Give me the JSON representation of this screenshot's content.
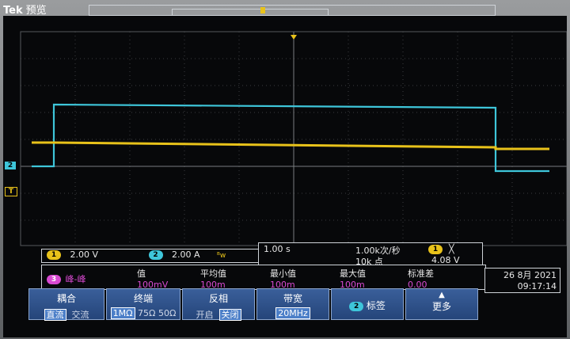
{
  "brand": {
    "logo": "Tek",
    "mode": "预览"
  },
  "channel_markers": {
    "ch2": "2",
    "trigger": "T"
  },
  "channel_readout": {
    "ch1_num": "1",
    "ch1_scale": "2.00 V",
    "ch2_num": "2",
    "ch2_scale": "2.00 A",
    "bw_mark": "ᴮw"
  },
  "timebase": {
    "time_div": "1.00 s",
    "sample_rate": "1.00k次/秒",
    "record_length": "10k 点",
    "trigger_ch": "1",
    "trigger_slope": "╳",
    "trigger_level": "4.08 V"
  },
  "measurement": {
    "source_num": "3",
    "type": "峰-峰",
    "headers": [
      "值",
      "平均值",
      "最小值",
      "最大值",
      "标准差"
    ],
    "values": [
      "100mV",
      "100m",
      "100m",
      "100m",
      "0.00"
    ]
  },
  "datetime": {
    "date": "26 8月 2021",
    "time": "09:17:14"
  },
  "menu": {
    "coupling_title": "耦合",
    "coupling_dc": "直流",
    "coupling_ac": "交流",
    "termination_title": "终端",
    "term_1m": "1MΩ",
    "term_75": "75Ω",
    "term_50": "50Ω",
    "invert_title": "反相",
    "invert_on": "开启",
    "invert_off": "关闭",
    "bandwidth_title": "带宽",
    "bandwidth_value": "20MHz",
    "label_ch": "2",
    "label_text": "标签",
    "more_text": "更多"
  },
  "colors": {
    "ch1": "#e8c21a",
    "ch2": "#3ec6da",
    "math": "#d94ad2",
    "menu_bg": "#2f4f86"
  }
}
